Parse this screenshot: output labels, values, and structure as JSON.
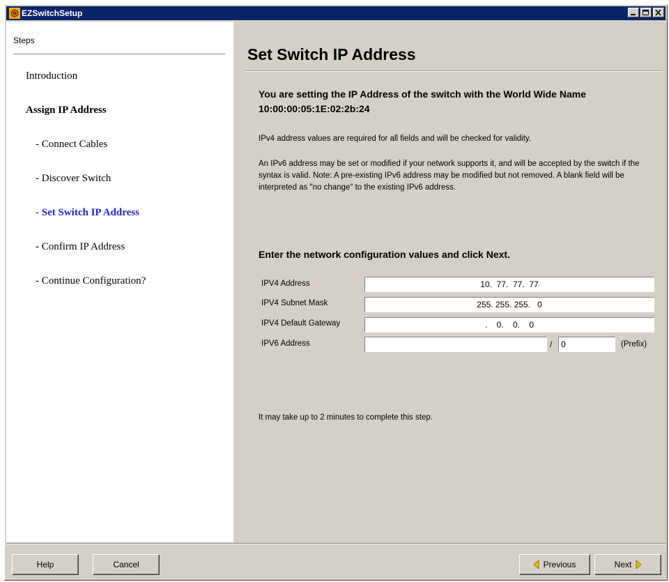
{
  "window": {
    "title": "EZSwitchSetup"
  },
  "steps": {
    "header": "Steps",
    "items": [
      {
        "label": "Introduction"
      },
      {
        "label": "Assign IP Address"
      },
      {
        "label": "- Connect Cables"
      },
      {
        "label": "- Discover Switch"
      },
      {
        "label": "- Set Switch IP Address"
      },
      {
        "label": "- Confirm IP Address"
      },
      {
        "label": "- Continue Configuration?"
      }
    ]
  },
  "main": {
    "title": "Set Switch IP Address",
    "intro_heading": "You are setting the IP Address of the switch with the World Wide Name 10:00:00:05:1E:02:2b:24",
    "para1": "IPv4 address values are required for all fields and will be checked for validity.",
    "para2": "An IPv6 address may be set or modified if your network supports it, and will be accepted by the switch if the syntax is valid. Note: A pre-existing IPv6 address may be modified but not removed. A blank field will be interpreted as \"no change\" to the existing IPv6 address.",
    "form_heading": "Enter the network configuration values and click Next.",
    "fields": {
      "ipv4_address": {
        "label": "IPV4 Address",
        "value": "10.  77.  77.  77"
      },
      "ipv4_subnet": {
        "label": "IPV4 Subnet Mask",
        "value": "255. 255. 255.   0"
      },
      "ipv4_gateway": {
        "label": "IPV4 Default Gateway",
        "value": ".    0.    0.    0"
      },
      "ipv6_address": {
        "label": "IPV6 Address",
        "value": "",
        "slash": "/",
        "prefix_value": "0",
        "prefix_label": "(Prefix)"
      }
    },
    "note": "It may take up to 2 minutes to complete this step."
  },
  "buttons": {
    "help": "Help",
    "cancel": "Cancel",
    "previous": "Previous",
    "next": "Next"
  },
  "colors": {
    "titlebar": "#0a246a",
    "active_step": "#1f25d8",
    "nav_arrow": "#e0c000"
  }
}
